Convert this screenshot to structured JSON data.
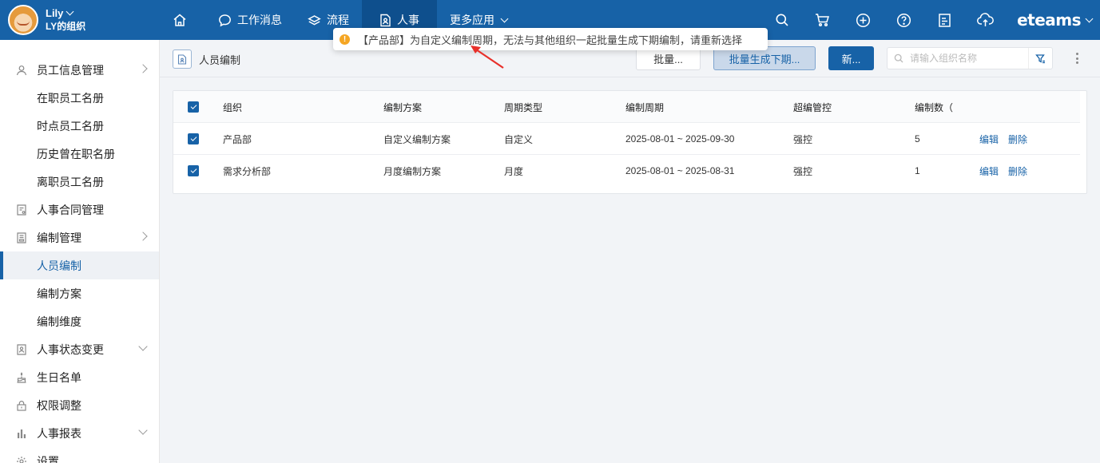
{
  "user": {
    "name": "Lily",
    "org": "LY的组织"
  },
  "nav": [
    {
      "label": "工作消息",
      "icon": "chat-icon"
    },
    {
      "label": "流程",
      "icon": "layers-icon"
    },
    {
      "label": "人事",
      "icon": "document-person-icon",
      "active": true
    },
    {
      "label": "更多应用",
      "icon": "chevron-down-icon"
    }
  ],
  "brand": "eteams",
  "sidebar": {
    "items": [
      {
        "label": "员工信息管理"
      },
      {
        "label": "在职员工名册"
      },
      {
        "label": "时点员工名册"
      },
      {
        "label": "历史曾在职名册"
      },
      {
        "label": "离职员工名册"
      },
      {
        "label": "人事合同管理"
      },
      {
        "label": "编制管理"
      },
      {
        "label": "人员编制"
      },
      {
        "label": "编制方案"
      },
      {
        "label": "编制维度"
      },
      {
        "label": "人事状态变更"
      },
      {
        "label": "生日名单"
      },
      {
        "label": "权限调整"
      },
      {
        "label": "人事报表"
      },
      {
        "label": "设置"
      }
    ]
  },
  "page": {
    "title": "人员编制"
  },
  "toolbar": {
    "batch_label": "批量...",
    "batch_generate_label": "批量生成下期...",
    "new_label": "新...",
    "search_placeholder": "请输入组织名称"
  },
  "toast": {
    "message": "【产品部】为自定义编制周期，无法与其他组织一起批量生成下期编制，请重新选择"
  },
  "table": {
    "headers": [
      "组织",
      "编制方案",
      "周期类型",
      "编制周期",
      "超编管控",
      "编制数（"
    ],
    "rows": [
      {
        "org": "产品部",
        "plan": "自定义编制方案",
        "cycle_type": "自定义",
        "period": "2025-08-01 ~ 2025-09-30",
        "control": "强控",
        "count": "5",
        "edit": "编辑",
        "delete": "删除"
      },
      {
        "org": "需求分析部",
        "plan": "月度编制方案",
        "cycle_type": "月度",
        "period": "2025-08-01 ~ 2025-08-31",
        "control": "强控",
        "count": "1",
        "edit": "编辑",
        "delete": "删除"
      }
    ]
  },
  "colors": {
    "primary": "#1762a7",
    "warning": "#f5a623",
    "annotation_arrow": "#e8302a"
  }
}
